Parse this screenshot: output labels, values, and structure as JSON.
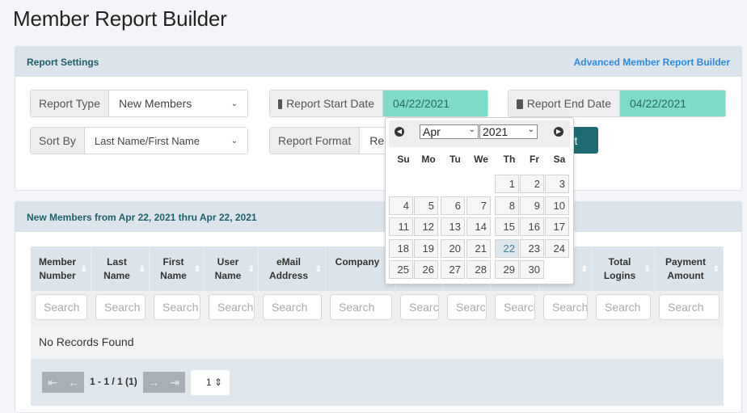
{
  "title": "Member Report Builder",
  "settings": {
    "header": "Report Settings",
    "advanced_link": "Advanced Member Report Builder",
    "report_type_label": "Report Type",
    "report_type_value": "New Members",
    "sort_by_label": "Sort By",
    "sort_by_value": "Last Name/First Name",
    "start_label": "Report Start Date",
    "start_value": "04/22/2021",
    "end_label": "Report End Date",
    "end_value": "04/22/2021",
    "format_label": "Report Format",
    "format_value": "Rep",
    "run_button": "ort"
  },
  "calendar": {
    "month": "Apr",
    "year": "2021",
    "weekdays": [
      "Su",
      "Mo",
      "Tu",
      "We",
      "Th",
      "Fr",
      "Sa"
    ],
    "first_weekday": 4,
    "days": 30,
    "selected": 22
  },
  "results": {
    "header": "New Members from Apr 22, 2021 thru Apr 22, 2021",
    "columns": [
      "Member Number",
      "Last Name",
      "First Name",
      "User Name",
      "eMail Address",
      "Company",
      "",
      "",
      "",
      "",
      "Total Logins",
      "Payment Amount"
    ],
    "search_placeholder": "Search",
    "empty": "No Records Found",
    "pager_text": "1 - 1 / 1 (1)",
    "page": "1"
  },
  "colors": {
    "accent": "#1f6b75",
    "link": "#2b8ae0",
    "highlight": "#7fdccb"
  }
}
